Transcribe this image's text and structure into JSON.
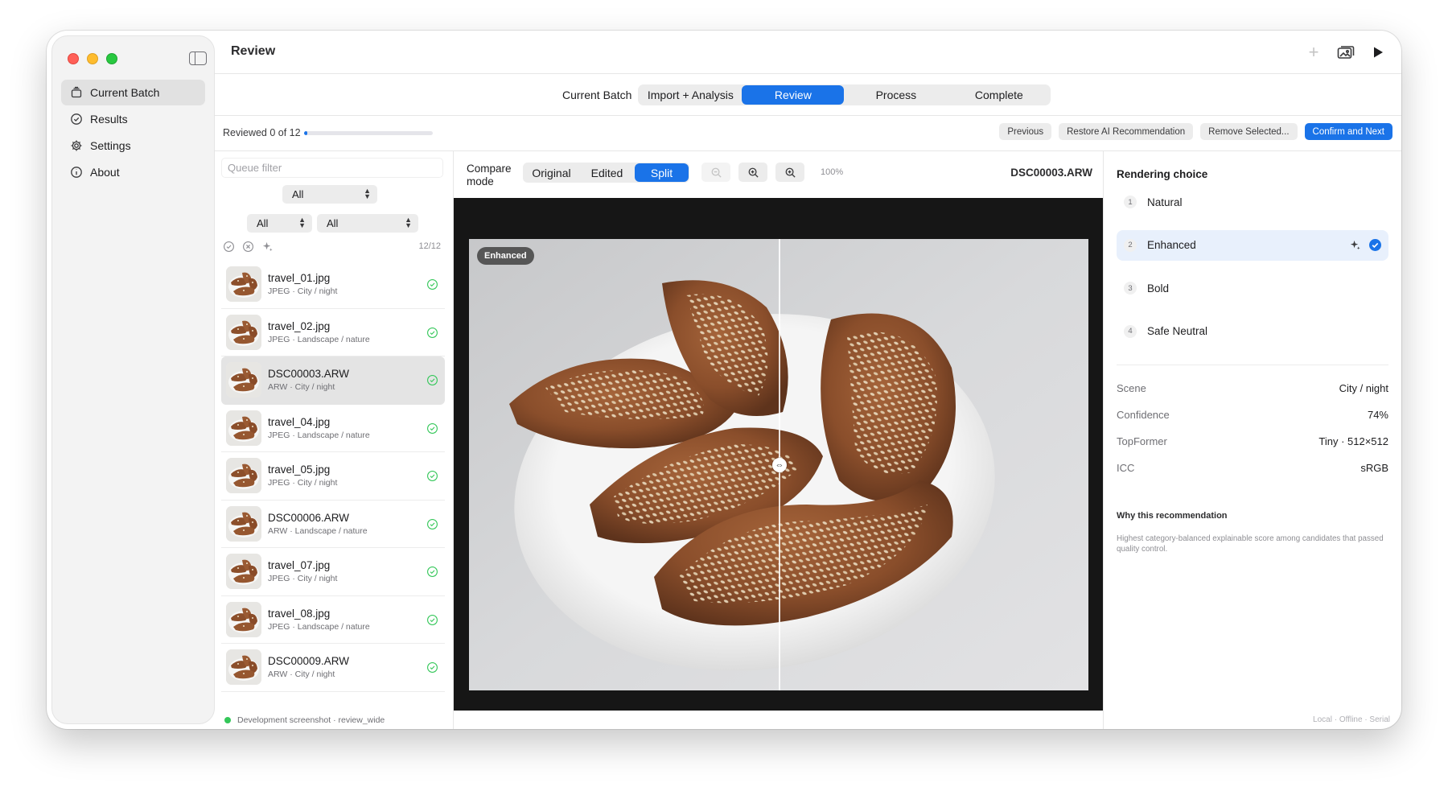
{
  "window": {
    "title": "Review",
    "toolbar": {
      "add_icon": "plus-icon",
      "photos_icon": "photos-icon",
      "run_icon": "play-icon"
    }
  },
  "sidebar": {
    "items": [
      {
        "label": "Current Batch",
        "icon": "batch-icon",
        "active": true
      },
      {
        "label": "Results",
        "icon": "checkmark-circle-icon",
        "active": false
      },
      {
        "label": "Settings",
        "icon": "gear-icon",
        "active": false
      },
      {
        "label": "About",
        "icon": "info-icon",
        "active": false
      }
    ]
  },
  "steps": {
    "label": "Current Batch",
    "items": [
      "Import + Analysis",
      "Review",
      "Process",
      "Complete"
    ],
    "active": "Review"
  },
  "review": {
    "status": "Reviewed 0 of 12",
    "progress": 0,
    "actions": {
      "previous": "Previous",
      "restore": "Restore AI Recommendation",
      "remove": "Remove Selected...",
      "confirm": "Confirm and Next"
    }
  },
  "queue": {
    "filter_placeholder": "Queue filter",
    "filters": [
      "All",
      "All",
      "All"
    ],
    "count": "12/12",
    "items": [
      {
        "name": "travel_01.jpg",
        "format": "JPEG",
        "scene": "City / night",
        "selected": false
      },
      {
        "name": "travel_02.jpg",
        "format": "JPEG",
        "scene": "Landscape / nature",
        "selected": false
      },
      {
        "name": "DSC00003.ARW",
        "format": "ARW",
        "scene": "City / night",
        "selected": true
      },
      {
        "name": "travel_04.jpg",
        "format": "JPEG",
        "scene": "Landscape / nature",
        "selected": false
      },
      {
        "name": "travel_05.jpg",
        "format": "JPEG",
        "scene": "City / night",
        "selected": false
      },
      {
        "name": "DSC00006.ARW",
        "format": "ARW",
        "scene": "Landscape / nature",
        "selected": false
      },
      {
        "name": "travel_07.jpg",
        "format": "JPEG",
        "scene": "City / night",
        "selected": false
      },
      {
        "name": "travel_08.jpg",
        "format": "JPEG",
        "scene": "Landscape / nature",
        "selected": false
      },
      {
        "name": "DSC00009.ARW",
        "format": "ARW",
        "scene": "City / night",
        "selected": false
      }
    ]
  },
  "compare": {
    "label": "Compare mode",
    "modes": [
      "Original",
      "Edited",
      "Split"
    ],
    "active": "Split",
    "zoom": "100%",
    "filename": "DSC00003.ARW",
    "badge": "Enhanced"
  },
  "rendering": {
    "title": "Rendering choice",
    "options": [
      {
        "num": "1",
        "label": "Natural",
        "selected": false
      },
      {
        "num": "2",
        "label": "Enhanced",
        "selected": true
      },
      {
        "num": "3",
        "label": "Bold",
        "selected": false
      },
      {
        "num": "4",
        "label": "Safe Neutral",
        "selected": false
      }
    ],
    "details": [
      {
        "key": "Scene",
        "value": "City / night"
      },
      {
        "key": "Confidence",
        "value": "74%"
      },
      {
        "key": "TopFormer",
        "value": "Tiny · 512×512"
      },
      {
        "key": "ICC",
        "value": "sRGB"
      }
    ],
    "why_title": "Why this recommendation",
    "why_text": "Highest category-balanced explainable score among candidates that passed quality control."
  },
  "status": {
    "left": "Development screenshot · review_wide",
    "right": "Local · Offline · Serial"
  },
  "colors": {
    "accent": "#1a73e8",
    "success": "#34c759"
  }
}
